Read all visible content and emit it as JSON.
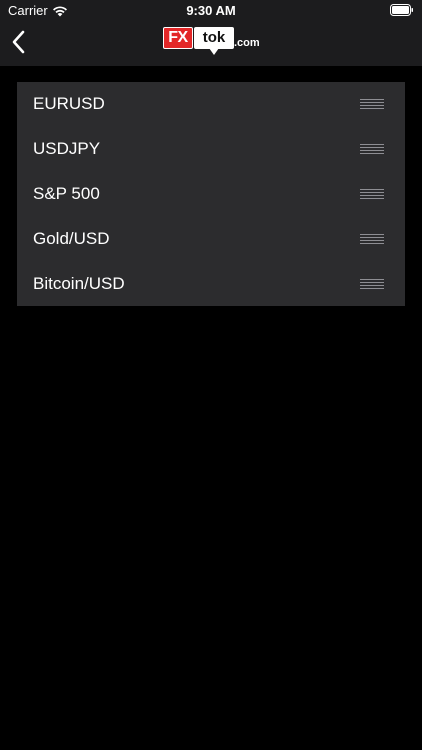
{
  "status_bar": {
    "carrier": "Carrier",
    "time": "9:30 AM"
  },
  "navbar": {
    "logo_fx": "FX",
    "logo_tok": "tok",
    "logo_com": ".com",
    "logo_color": "#e32728"
  },
  "instruments": [
    {
      "label": "EURUSD"
    },
    {
      "label": "USDJPY"
    },
    {
      "label": "S&P 500"
    },
    {
      "label": "Gold/USD"
    },
    {
      "label": "Bitcoin/USD"
    }
  ]
}
